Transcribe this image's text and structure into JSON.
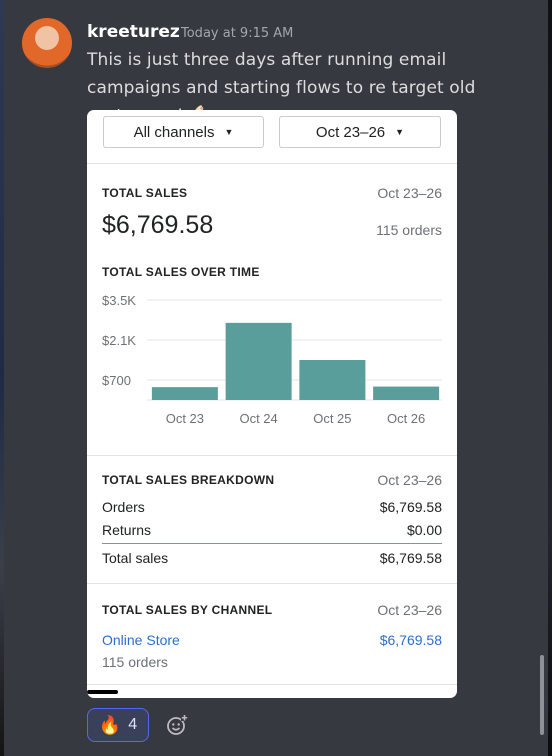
{
  "message": {
    "author": "kreeturez",
    "timestamp": "Today at 9:15 AM",
    "text": "This is just three days after running email campaigns and starting flows to re target old customers!",
    "emoji": "💪🏻"
  },
  "card": {
    "filters": {
      "channel": "All channels",
      "date_range": "Oct 23–26"
    },
    "total_sales": {
      "label": "TOTAL SALES",
      "period": "Oct 23–26",
      "amount": "$6,769.58",
      "orders": "115 orders"
    },
    "over_time": {
      "label": "TOTAL SALES OVER TIME"
    },
    "breakdown": {
      "label": "TOTAL SALES BREAKDOWN",
      "period": "Oct 23–26",
      "orders_label": "Orders",
      "orders_value": "$6,769.58",
      "returns_label": "Returns",
      "returns_value": "$0.00",
      "total_label": "Total sales",
      "total_value": "$6,769.58"
    },
    "by_channel": {
      "label": "TOTAL SALES BY CHANNEL",
      "period": "Oct 23–26",
      "channel_name": "Online Store",
      "channel_value": "$6,769.58",
      "channel_orders": "115 orders"
    }
  },
  "reactions": {
    "emoji": "🔥",
    "count": "4",
    "add_icon": "add-reaction-icon"
  },
  "colors": {
    "bar": "#5a9e9c",
    "link": "#2c6ecb",
    "reaction_border": "#5865f2"
  },
  "chart_data": {
    "type": "bar",
    "categories": [
      "Oct 23",
      "Oct 24",
      "Oct 25",
      "Oct 26"
    ],
    "values": [
      450,
      2700,
      1400,
      470
    ],
    "ytick_labels": [
      "$3.5K",
      "$2.1K",
      "$700"
    ],
    "yticks": [
      3500,
      2100,
      700
    ],
    "ylim": [
      0,
      3500
    ],
    "grid": true,
    "title": "TOTAL SALES OVER TIME"
  }
}
